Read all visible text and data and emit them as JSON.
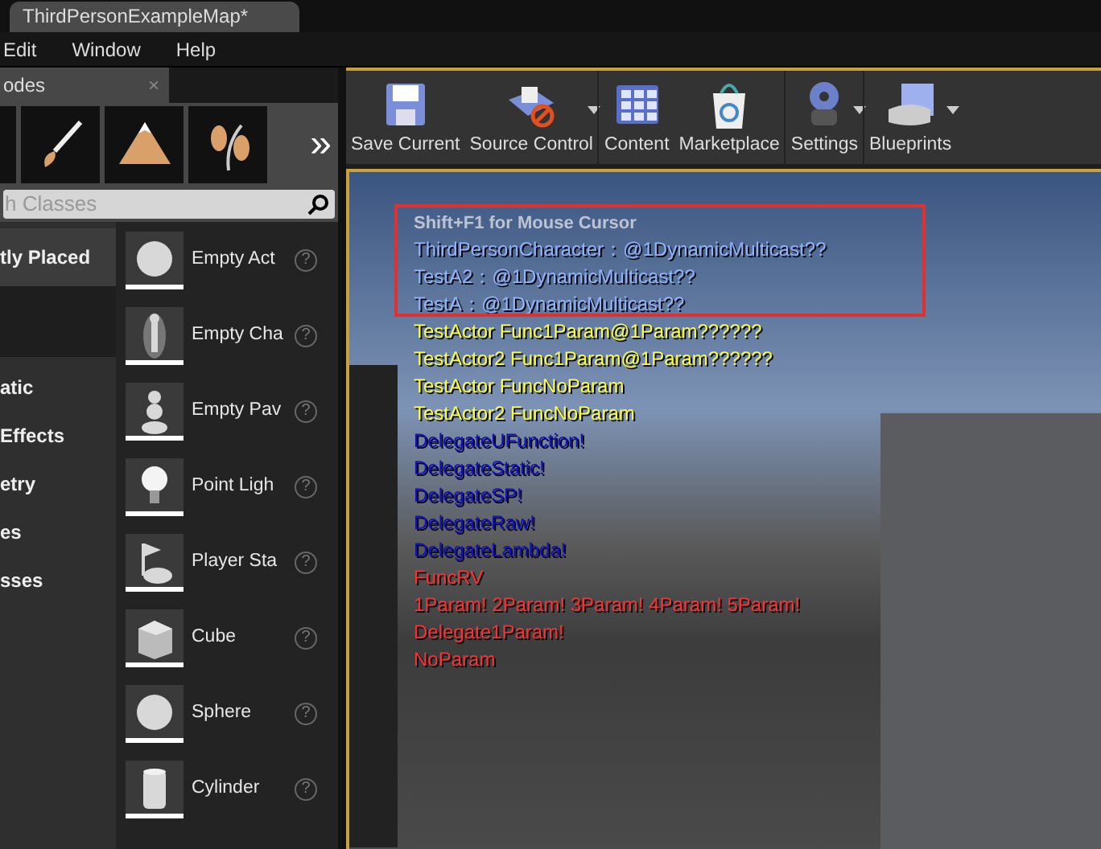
{
  "window": {
    "title": "ThirdPersonExampleMap*"
  },
  "menu": [
    "Edit",
    "Window",
    "Help"
  ],
  "modes_panel": {
    "title": "odes",
    "close": "×",
    "more": "»",
    "search": {
      "placeholder": "h Classes"
    },
    "categories": [
      {
        "label": "tly Placed",
        "selected": true
      },
      {
        "label": "atic",
        "selected": false
      },
      {
        "label": "Effects",
        "selected": false
      },
      {
        "label": "etry",
        "selected": false
      },
      {
        "label": "es",
        "selected": false
      },
      {
        "label": "sses",
        "selected": false
      }
    ],
    "items": [
      {
        "label": "Empty Act",
        "kind": "sphere",
        "help": "?"
      },
      {
        "label": "Empty Cha",
        "kind": "character",
        "help": "?"
      },
      {
        "label": "Empty Pav",
        "kind": "pawn",
        "help": "?"
      },
      {
        "label": "Point Ligh",
        "kind": "light",
        "help": "?"
      },
      {
        "label": "Player Sta",
        "kind": "start",
        "help": "?"
      },
      {
        "label": "Cube",
        "kind": "cube",
        "help": "?"
      },
      {
        "label": "Sphere",
        "kind": "sphere",
        "help": "?"
      },
      {
        "label": "Cylinder",
        "kind": "cylinder",
        "help": "?"
      }
    ]
  },
  "toolbar": [
    {
      "label": "Save Current",
      "kind": "save",
      "dropdown": false
    },
    {
      "label": "Source Control",
      "kind": "source",
      "dropdown": true
    },
    {
      "label": "Content",
      "kind": "content",
      "dropdown": false
    },
    {
      "label": "Marketplace",
      "kind": "market",
      "dropdown": false
    },
    {
      "label": "Settings",
      "kind": "settings",
      "dropdown": true
    },
    {
      "label": "Blueprints",
      "kind": "blueprints",
      "dropdown": true
    }
  ],
  "viewport": {
    "hint": "Shift+F1 for Mouse Cursor",
    "log": [
      {
        "text": "ThirdPersonCharacter：@1DynamicMulticast??",
        "color": "#8fb4ff",
        "highlighted": true
      },
      {
        "text": "TestA2：@1DynamicMulticast??",
        "color": "#8fb4ff",
        "highlighted": true
      },
      {
        "text": "TestA：@1DynamicMulticast??",
        "color": "#8fb4ff",
        "highlighted": true
      },
      {
        "text": "TestActor Func1Param@1Param??????",
        "color": "#ffff33",
        "highlighted": false
      },
      {
        "text": "TestActor2 Func1Param@1Param??????",
        "color": "#ffff33",
        "highlighted": false
      },
      {
        "text": "TestActor FuncNoParam",
        "color": "#ffff33",
        "highlighted": false
      },
      {
        "text": "TestActor2 FuncNoParam",
        "color": "#ffff33",
        "highlighted": false
      },
      {
        "text": "DelegateUFunction!",
        "color": "#1010c8",
        "highlighted": false
      },
      {
        "text": "DelegateStatic!",
        "color": "#1010c8",
        "highlighted": false
      },
      {
        "text": "DelegateSP!",
        "color": "#1010c8",
        "highlighted": false
      },
      {
        "text": "DelegateRaw!",
        "color": "#1010c8",
        "highlighted": false
      },
      {
        "text": "DelegateLambda!",
        "color": "#1010c8",
        "highlighted": false
      },
      {
        "text": "FuncRV",
        "color": "#ff3030",
        "highlighted": false
      },
      {
        "text": "1Param! 2Param! 3Param! 4Param! 5Param!",
        "color": "#ff3030",
        "highlighted": false
      },
      {
        "text": "Delegate1Param!",
        "color": "#ff3030",
        "highlighted": false
      },
      {
        "text": "NoParam",
        "color": "#ff3030",
        "highlighted": false
      }
    ]
  }
}
